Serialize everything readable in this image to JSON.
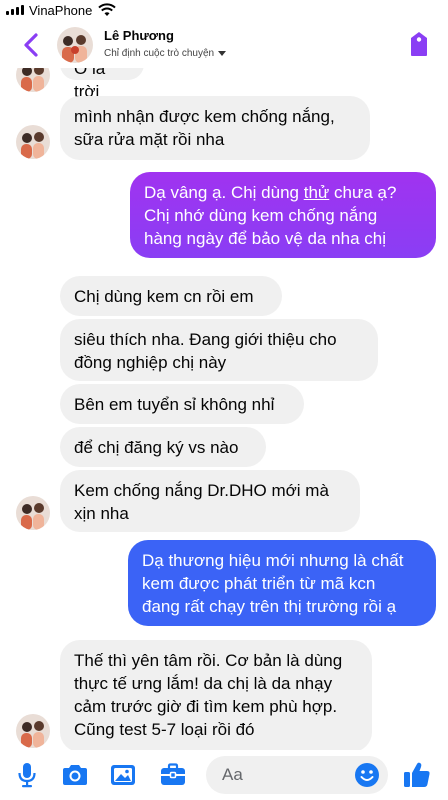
{
  "status_bar": {
    "carrier": "VinaPhone"
  },
  "header": {
    "name": "Lê Phương",
    "subtitle": "Chỉ định cuộc trò chuyện"
  },
  "messages": [
    {
      "from": "them",
      "lines": [
        "Ô la trời"
      ]
    },
    {
      "from": "them",
      "lines": [
        "mình nhận được kem chống nắng,",
        "sữa rửa mặt rồi nha"
      ]
    },
    {
      "from": "me",
      "lines": [
        "Dạ vâng ạ. Chị dùng thử chưa ạ?",
        "Chị nhớ dùng kem chống nắng",
        "hàng ngày để bảo vệ da nha chị"
      ]
    },
    {
      "from": "them",
      "lines": [
        "Chị dùng kem cn rồi em"
      ]
    },
    {
      "from": "them",
      "lines": [
        "siêu thích nha. Đang giới thiệu cho",
        "đồng nghiệp chị này"
      ]
    },
    {
      "from": "them",
      "lines": [
        "Bên em tuyển sỉ không nhỉ"
      ]
    },
    {
      "from": "them",
      "lines": [
        "để chị đăng ký vs nào"
      ]
    },
    {
      "from": "them",
      "lines": [
        "Kem chống nắng Dr.DHO mới mà",
        "xịn nha"
      ]
    },
    {
      "from": "me",
      "lines": [
        "Dạ thương hiệu mới nhưng là chất",
        "kem được phát triển từ mã kcn",
        "đang rất chạy trên thị trường rồi ạ"
      ]
    },
    {
      "from": "them",
      "lines": [
        "Thế thì yên tâm rồi. Cơ bản là dùng",
        "thực tế ưng lắm! da chị là da nhạy",
        "cảm trước giờ đi tìm kem phù hợp.",
        "Cũng test 5-7 loại rồi đó"
      ]
    }
  ],
  "composer": {
    "placeholder": "Aa"
  },
  "colors": {
    "accent": "#8a3ef4",
    "bubble_out_purple": "#9b35f2",
    "bubble_out_blue": "#3b63f6",
    "bubble_in": "#f0f0f0",
    "icon_blue": "#1877f2"
  },
  "icons": {
    "back": "chevron-left-icon",
    "tag": "tag-icon",
    "mic": "microphone-icon",
    "camera": "camera-icon",
    "gallery": "image-icon",
    "briefcase": "briefcase-icon",
    "emoji": "smiley-icon",
    "like": "thumbs-up-icon"
  }
}
